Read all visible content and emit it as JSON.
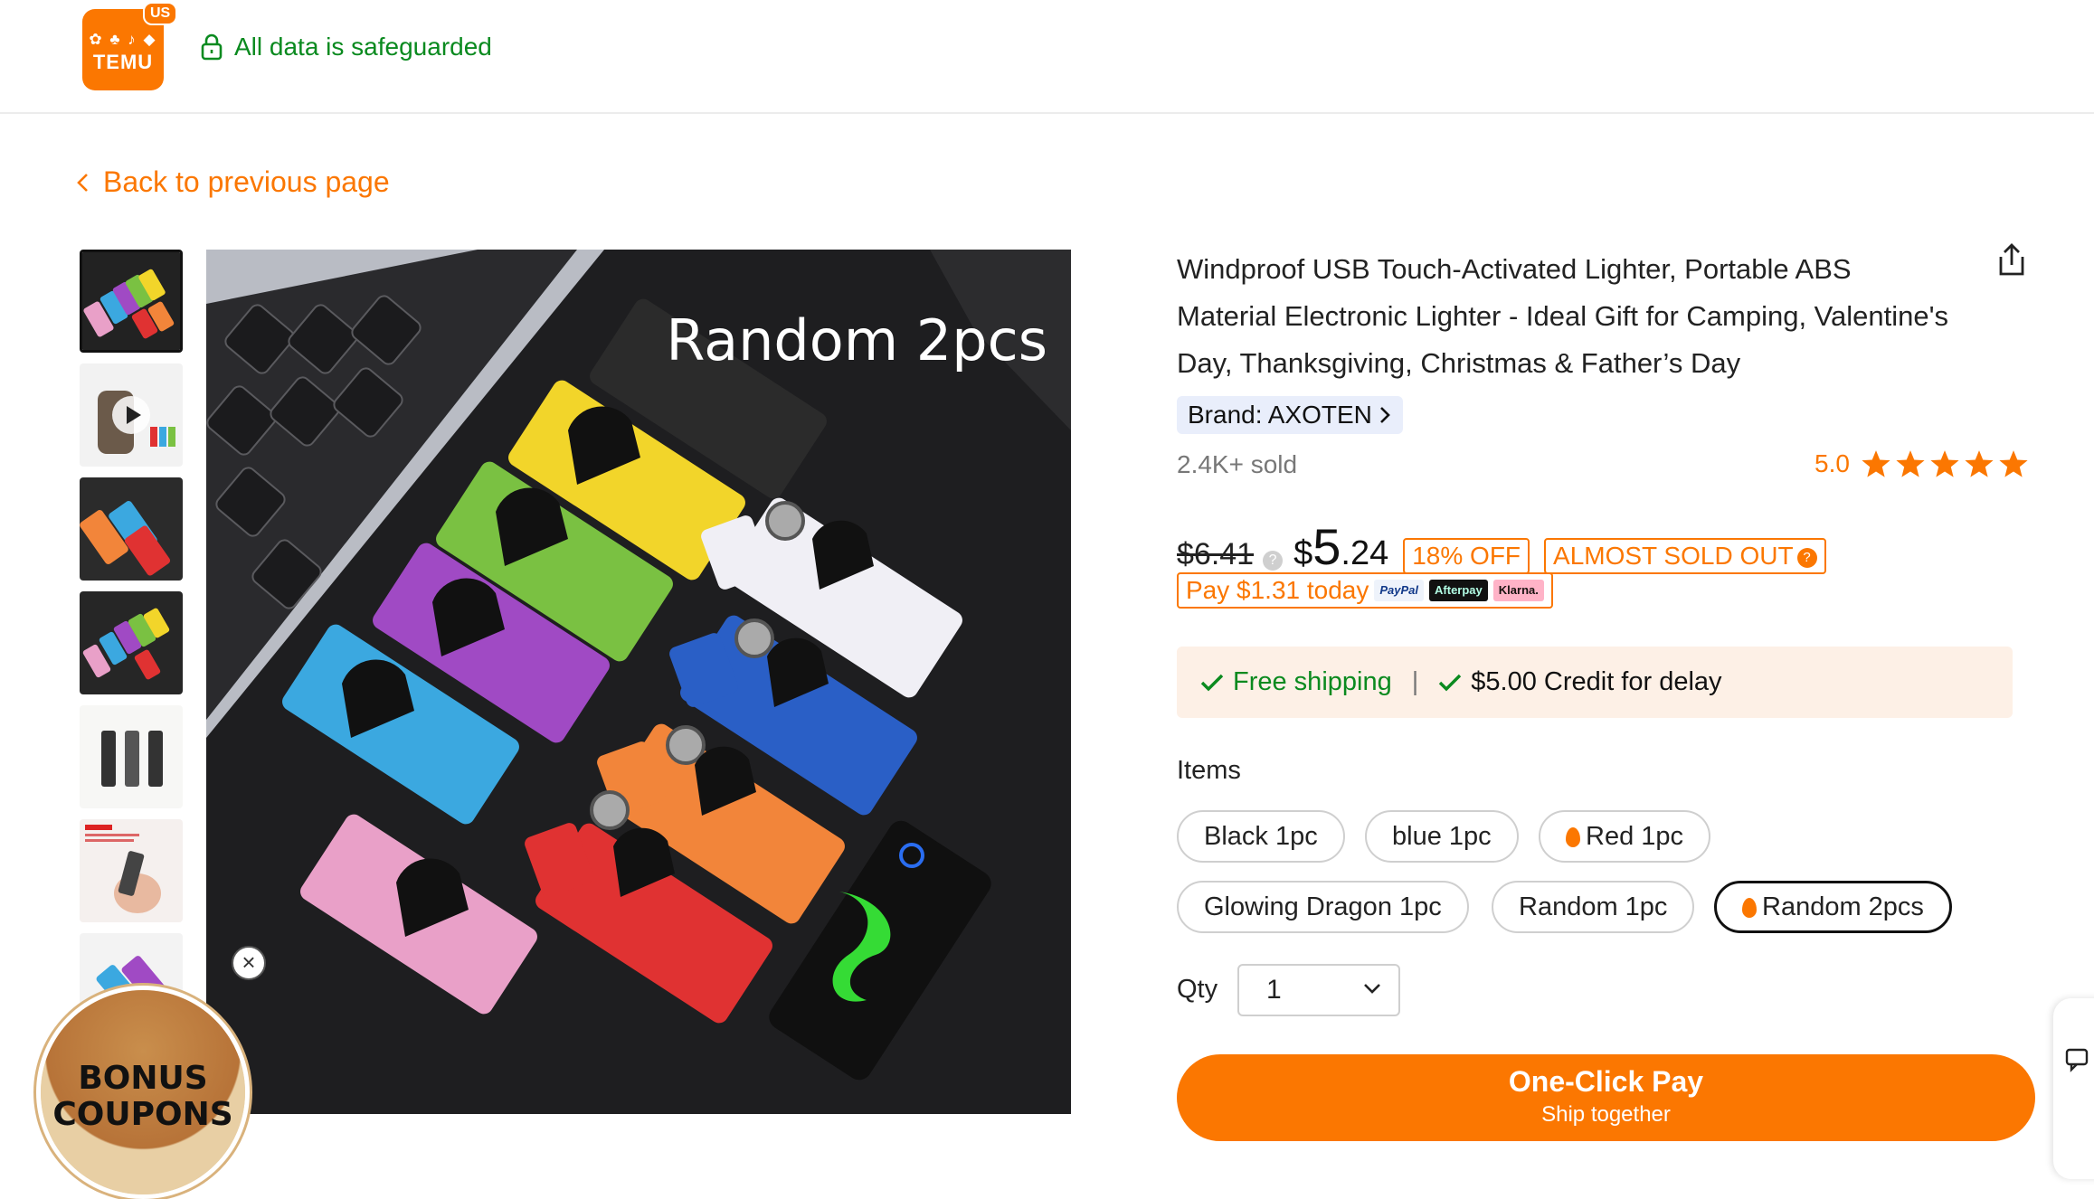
{
  "header": {
    "logo_text": "TEMU",
    "logo_region": "US",
    "security_text": "All data is safeguarded"
  },
  "nav": {
    "back_label": "Back to previous page"
  },
  "gallery": {
    "main_caption": "Random 2pcs",
    "thumbnail_count": 7,
    "active_thumbnail": 1
  },
  "promo": {
    "bonus_line1": "BONUS",
    "bonus_line2": "COUPONS"
  },
  "product": {
    "title": "Windproof USB Touch-Activated Lighter, Portable ABS Material Electronic Lighter - Ideal Gift for Camping, Valentine's Day, Thanksgiving, Christmas & Father’s Day",
    "brand": "Brand: AXOTEN",
    "sold": "2.4K+ sold",
    "rating": "5.0",
    "stars": 5
  },
  "pricing": {
    "old_price": "$6.41",
    "price_symbol": "$",
    "price_whole": "5",
    "price_cents": ".24",
    "discount": "18% OFF",
    "stock_badge": "ALMOST SOLD OUT",
    "pay_today": "Pay $1.31 today",
    "pay_providers": [
      "PayPal",
      "Afterpay",
      "Klarna."
    ]
  },
  "shipping": {
    "free": "Free shipping",
    "separator": "|",
    "credit": "$5.00 Credit for delay"
  },
  "items": {
    "label": "Items",
    "options": [
      {
        "label": "Black 1pc",
        "hot": false,
        "selected": false
      },
      {
        "label": "blue 1pc",
        "hot": false,
        "selected": false
      },
      {
        "label": "Red 1pc",
        "hot": true,
        "selected": false
      },
      {
        "label": "Glowing Dragon 1pc",
        "hot": false,
        "selected": false
      },
      {
        "label": "Random 1pc",
        "hot": false,
        "selected": false
      },
      {
        "label": "Random 2pcs",
        "hot": true,
        "selected": true
      }
    ]
  },
  "quantity": {
    "label": "Qty",
    "value": "1"
  },
  "cta": {
    "line1": "One-Click Pay",
    "line2": "Ship together"
  },
  "colors": {
    "accent": "#fb7701",
    "success": "#0a8a1f",
    "lighter_colors": [
      "#e9a0c8",
      "#3ba8e0",
      "#a04ac4",
      "#7ac142",
      "#f2d52a",
      "#222222",
      "#f0eff5",
      "#2a5fc6",
      "#f2853a",
      "#e03232",
      "#101010"
    ]
  }
}
